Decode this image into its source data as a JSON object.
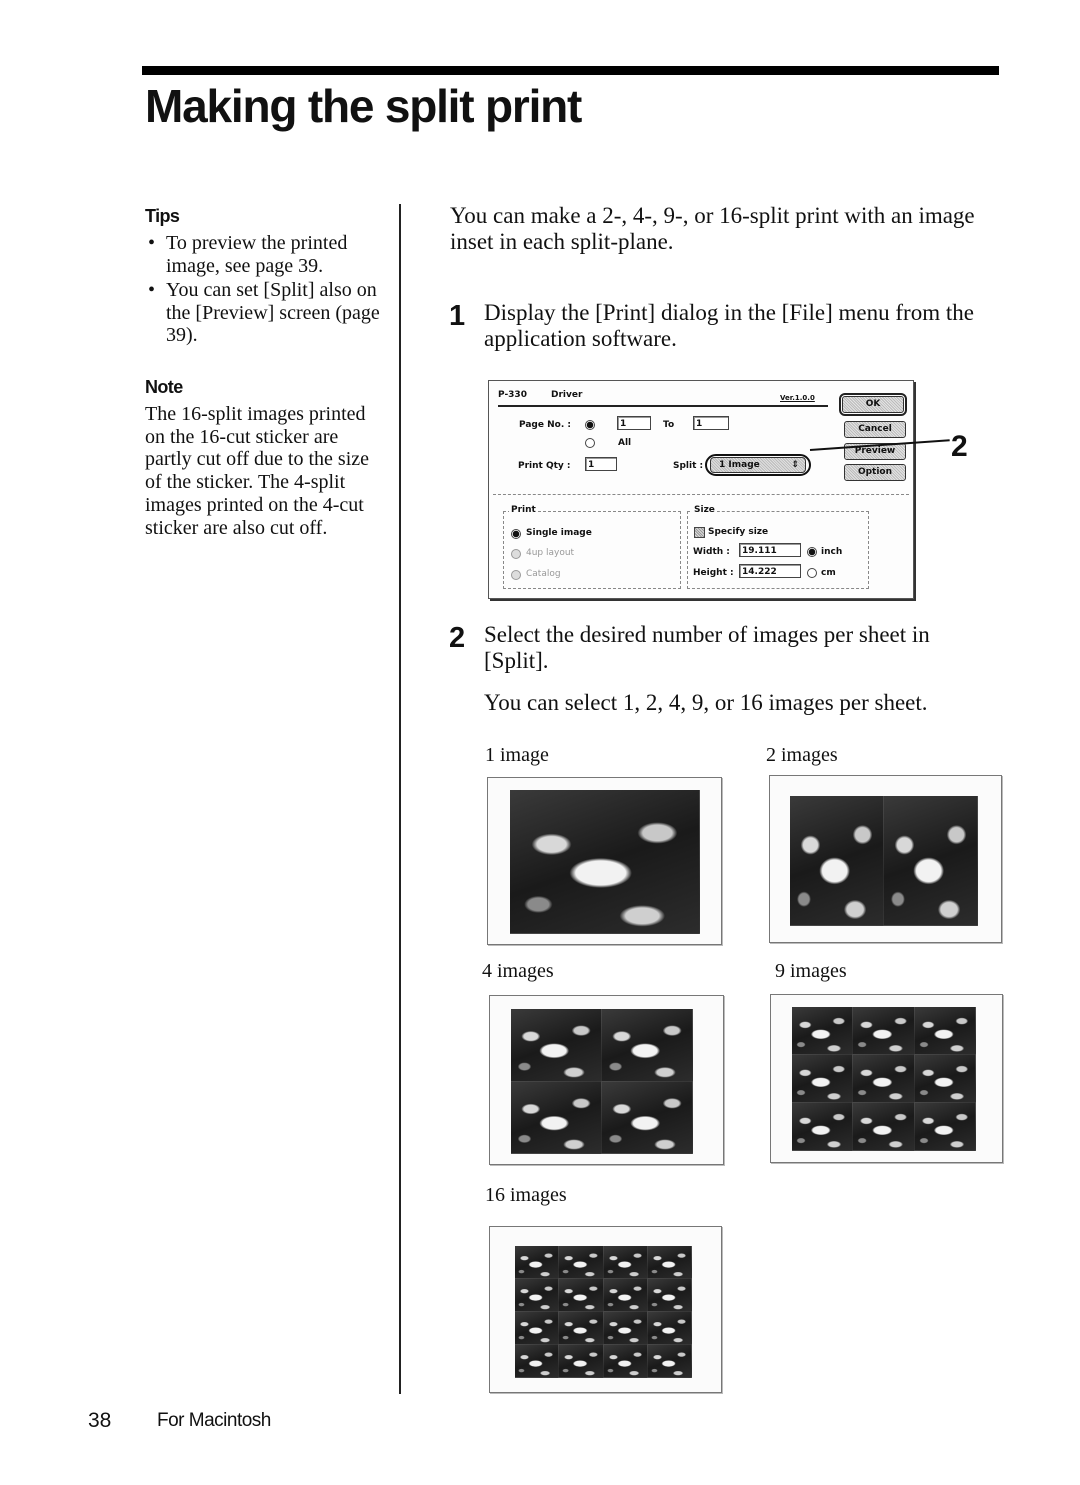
{
  "page": {
    "title": "Making the split print",
    "page_number": "38",
    "footer_label": "For Macintosh"
  },
  "sidebar": {
    "tips_heading": "Tips",
    "tips": [
      "To preview the printed image, see page 39.",
      "You can set [Split] also on the [Preview] screen (page 39)."
    ],
    "bullet": "•",
    "note_heading": "Note",
    "note_body": "The 16-split images printed on the 16-cut sticker are partly cut off due to the size of the sticker.  The 4-split images printed on the 4-cut sticker are also cut off."
  },
  "main": {
    "intro": "You can make a 2-, 4-, 9-, or 16-split print with an image inset in each split-plane.",
    "steps": [
      {
        "number": "1",
        "text": "Display the [Print] dialog in the [File] menu from the application software."
      },
      {
        "number": "2",
        "text": "Select the desired number of images per sheet in [Split].",
        "sub": "You can select 1, 2, 4, 9, or 16 images per sheet."
      }
    ],
    "callout_number": "2"
  },
  "dialog": {
    "model": "P-330",
    "title": "Driver",
    "version": "Ver.1.0.0",
    "page_no_label": "Page No. :",
    "page_from": "1",
    "to_label": "To",
    "page_to": "1",
    "all_label": "All",
    "print_qty_label": "Print Qty :",
    "print_qty": "1",
    "split_label": "Split :",
    "split_value": "1 Image",
    "popup_arrows": "⇕",
    "buttons": {
      "ok": "OK",
      "cancel": "Cancel",
      "preview": "Preview",
      "option": "Option"
    },
    "print_group": {
      "label": "Print",
      "options": [
        "Single image",
        "4up layout",
        "Catalog"
      ],
      "selected": "Single image"
    },
    "size_group": {
      "label": "Size",
      "specify_size": "Specify size",
      "width_label": "Width :",
      "width": "19.111",
      "height_label": "Height :",
      "height": "14.222",
      "units": [
        "inch",
        "cm"
      ],
      "selected_unit": "inch"
    }
  },
  "samples": [
    {
      "label": "1 image",
      "cols": 1,
      "rows": 1
    },
    {
      "label": "2 images",
      "cols": 2,
      "rows": 1
    },
    {
      "label": "4 images",
      "cols": 2,
      "rows": 2
    },
    {
      "label": "9 images",
      "cols": 3,
      "rows": 3
    },
    {
      "label": "16 images",
      "cols": 4,
      "rows": 4
    }
  ]
}
